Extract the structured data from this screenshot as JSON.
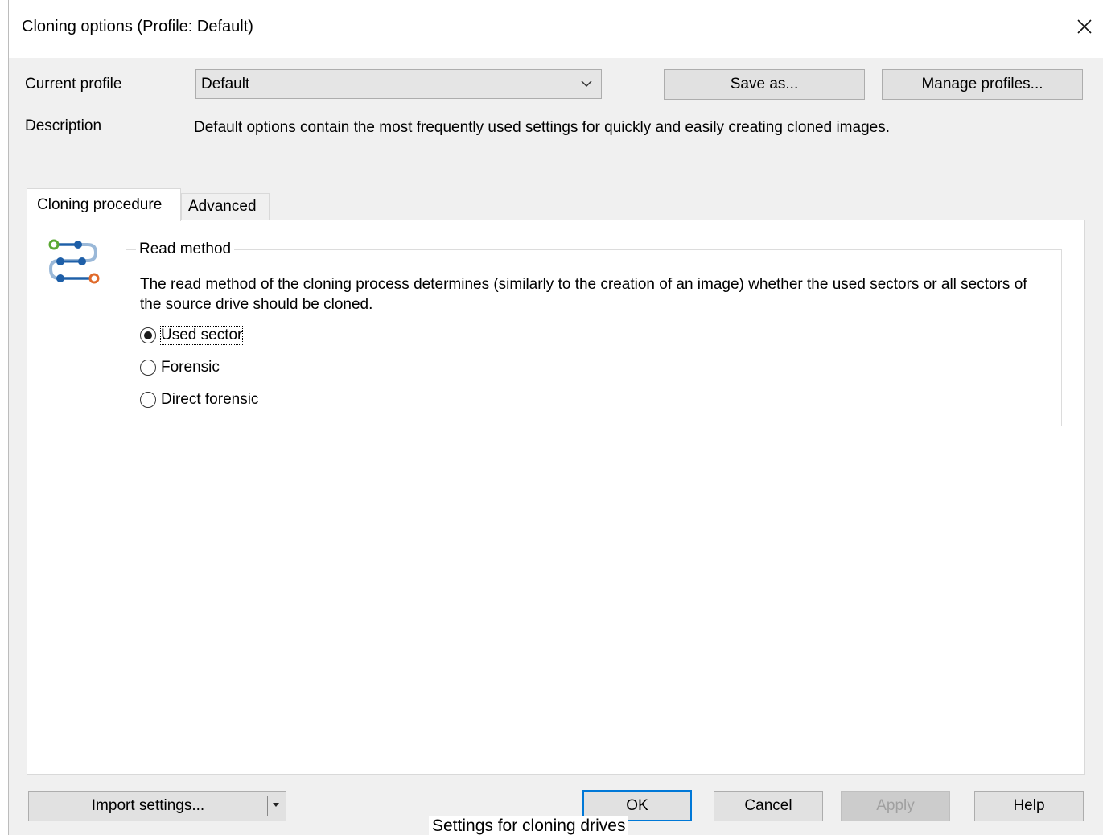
{
  "window": {
    "title": "Cloning options (Profile: Default)"
  },
  "profile": {
    "label": "Current profile",
    "value": "Default",
    "save_as": "Save as...",
    "manage": "Manage profiles..."
  },
  "description": {
    "label": "Description",
    "text": "Default options contain the most frequently used settings for quickly and easily creating cloned images."
  },
  "tabs": [
    {
      "label": "Cloning procedure",
      "active": true
    },
    {
      "label": "Advanced",
      "active": false
    }
  ],
  "read_method": {
    "legend": "Read method",
    "text": "The read method of the cloning process determines (similarly to the creation of an image) whether the used sectors or all sectors of the source drive should be cloned.",
    "options": [
      {
        "label": "Used sector",
        "selected": true
      },
      {
        "label": "Forensic",
        "selected": false
      },
      {
        "label": "Direct forensic",
        "selected": false
      }
    ]
  },
  "footer": {
    "import": "Import settings...",
    "ok": "OK",
    "cancel": "Cancel",
    "apply": "Apply",
    "help": "Help"
  },
  "caption": "Settings for cloning drives",
  "colors": {
    "accent": "#0078d7",
    "icon_blue": "#1e5fa8",
    "icon_green": "#5aa832",
    "icon_orange": "#e06a2a"
  }
}
